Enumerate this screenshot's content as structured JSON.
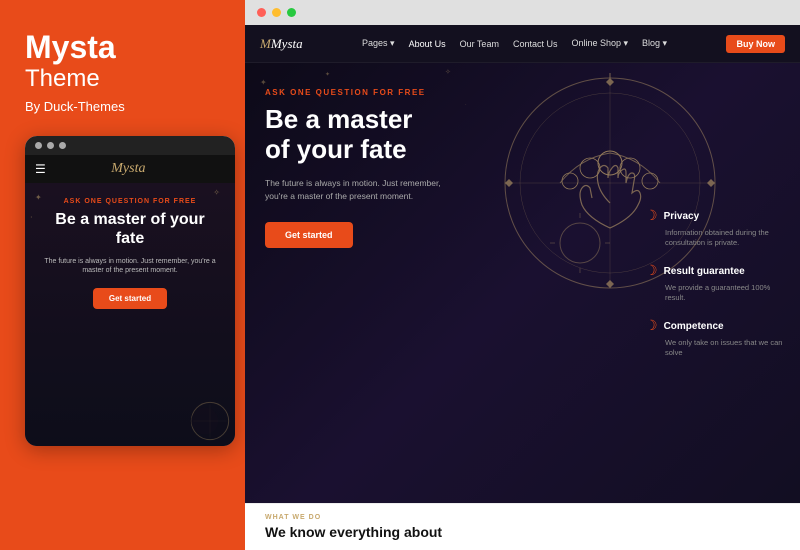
{
  "left": {
    "brand_name": "Mysta",
    "brand_subtitle": "Theme",
    "brand_by": "By Duck-Themes",
    "mobile": {
      "logo": "Mysta",
      "hero_tag": "ASK ONE QUESTION FOR FREE",
      "hero_title": "Be a master of your fate",
      "hero_desc": "The future is always in motion. Just remember, you're a master of the present moment.",
      "cta_label": "Get started"
    }
  },
  "right": {
    "nav": {
      "logo": "Mysta",
      "links": [
        "Pages ▾",
        "About Us",
        "Our Team",
        "Contact Us",
        "Online Shop ▾",
        "Blog ▾"
      ],
      "buy_label": "Buy Now"
    },
    "hero": {
      "tag": "ASK ONE QUESTION FOR FREE",
      "title_line1": "Be a master",
      "title_line2": "of your fate",
      "description": "The future is always in motion. Just remember, you're a master of the present moment.",
      "cta_label": "Get started"
    },
    "features": [
      {
        "title": "Privacy",
        "desc": "Information obtained during the consultation is private."
      },
      {
        "title": "Result guarantee",
        "desc": "We provide a guaranteed 100% result."
      },
      {
        "title": "Competence",
        "desc": "We only take on issues that we can solve"
      }
    ],
    "bottom": {
      "tag": "WHAT WE DO",
      "title": "We know everything about"
    }
  }
}
